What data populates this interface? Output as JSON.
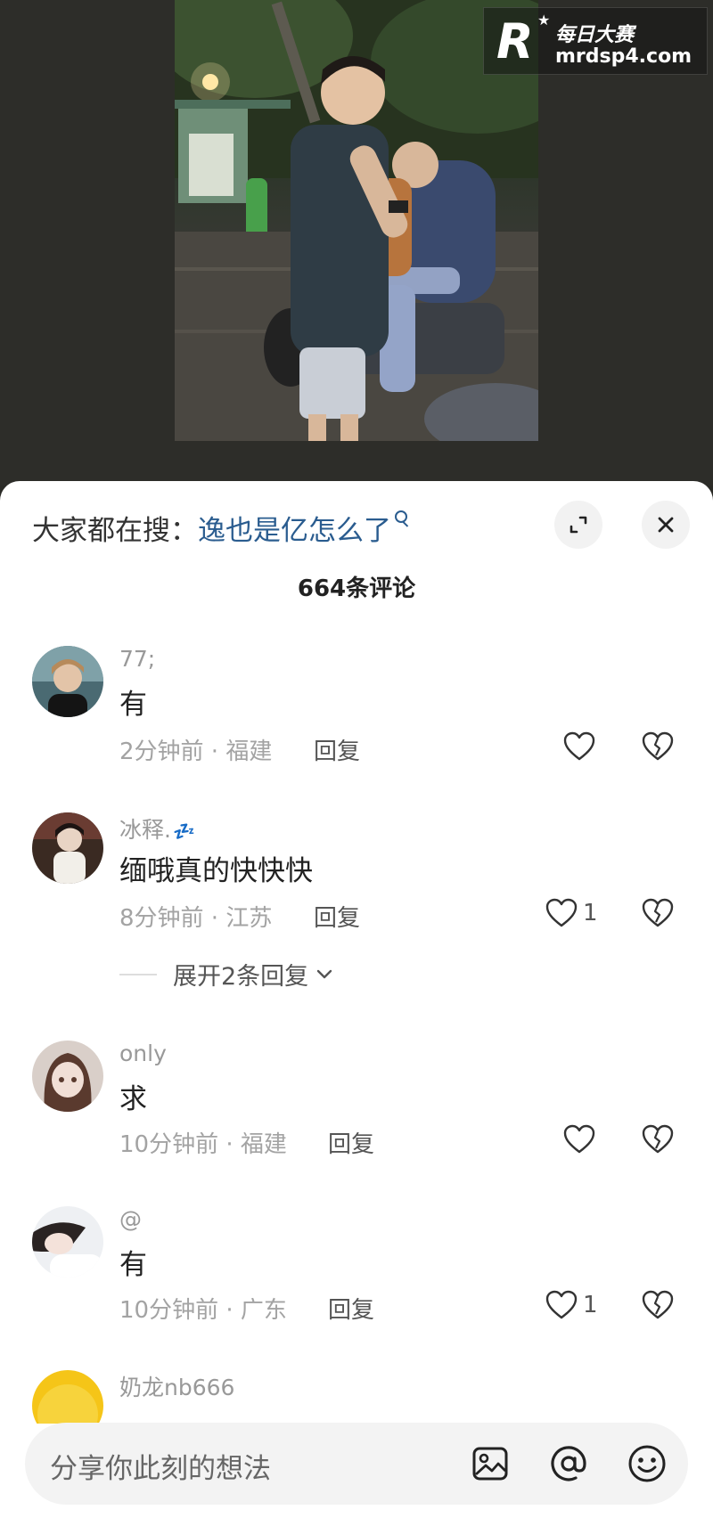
{
  "watermark": {
    "logo": "R",
    "brand": "每日大赛",
    "site": "mrdsp4.com"
  },
  "sheet": {
    "search_prefix": "大家都在搜：",
    "search_term": "逸也是亿怎么了",
    "comment_count": "664条评论"
  },
  "comments": [
    {
      "username": "77;",
      "content": "有",
      "meta": "2分钟前 · 福建",
      "reply": "回复",
      "likes": ""
    },
    {
      "username": "冰释.",
      "username_emoji": "💤",
      "content": "缅哦真的快快快",
      "meta": "8分钟前 · 江苏",
      "reply": "回复",
      "likes": "1",
      "expand": "展开2条回复"
    },
    {
      "username": "only",
      "content": "求",
      "meta": "10分钟前 · 福建",
      "reply": "回复",
      "likes": ""
    },
    {
      "username": "@",
      "content": "有",
      "meta": "10分钟前 · 广东",
      "reply": "回复",
      "likes": "1"
    },
    {
      "username": "奶龙nb666"
    }
  ],
  "input": {
    "placeholder": "分享你此刻的想法"
  },
  "colors": {
    "search_term": "#2a5c8f",
    "sheet_bg": "#ffffff",
    "backdrop": "#2b2b27"
  },
  "icons": [
    "expand-icon",
    "close-icon",
    "heart-icon",
    "dislike-heart-icon",
    "image-icon",
    "at-icon",
    "emoji-icon"
  ]
}
